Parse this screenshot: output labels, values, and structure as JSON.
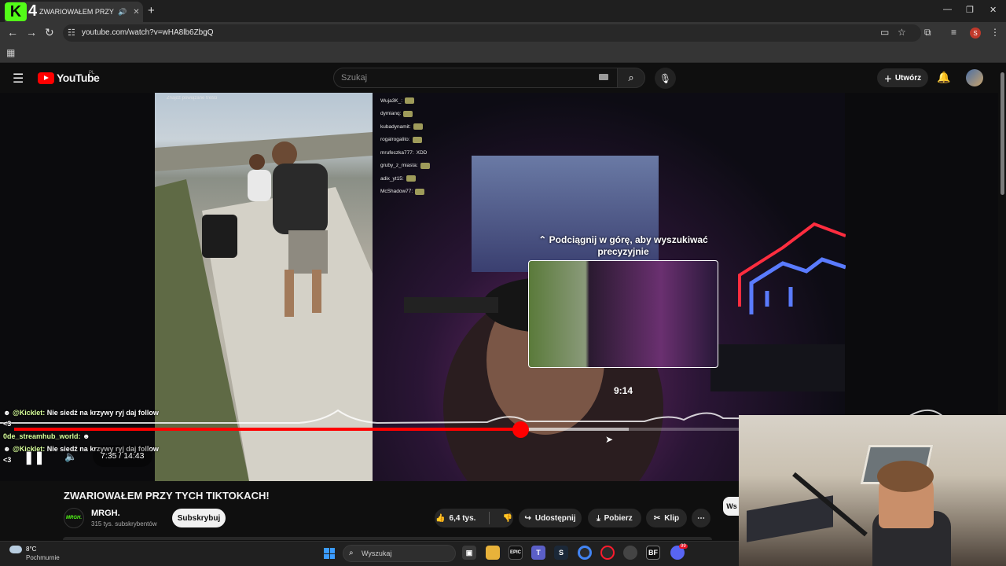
{
  "browser": {
    "tab_title": "ZWARIOWAŁEM PRZY TYCH",
    "tab_logo": "K",
    "tab_badge": "4",
    "url": "youtube.com/watch?v=wHA8lb6ZbgQ",
    "profile_initial": "S"
  },
  "youtube": {
    "logo_text": "YouTube",
    "country_code": "PL",
    "search_placeholder": "Szukaj",
    "create_label": "Utwórz"
  },
  "player": {
    "seek_hint": "Podciągnij w górę, aby wyszukiwać precyzyjnie",
    "preview_time": "9:14",
    "time_display": "7:35 / 14:43",
    "progress_fraction": 0.515,
    "tiktok_hint": "Znajdź powiązane treści",
    "chat_users": [
      "Wuja3K_:",
      "dymianq:",
      "kubadynamit:",
      "rogalrogalito:",
      "mrufeczka777:",
      "gruby_z_miasta:",
      "adix_yt15:",
      "McShadow77:"
    ],
    "chat_xdd": "XDD",
    "kick_chat": [
      {
        "user": "@Kicklet:",
        "text": "Nie siedź na krzywy ryj daj follow",
        "suffix": "<3"
      },
      {
        "user": "0de_streamhub_world:",
        "text": "",
        "suffix": ""
      },
      {
        "user": "@Kicklet:",
        "text": "Nie siedź na krzywy ryj daj follow",
        "suffix": "<3"
      }
    ]
  },
  "video": {
    "title": "ZWARIOWAŁEM PRZY TYCH TIKTOKACH!",
    "channel_name": "MRGH.",
    "channel_avatar_text": "MRGH.",
    "subscribers": "315 tys. subskrybentów",
    "subscribe_label": "Subskrybuj",
    "likes": "6,4 tys.",
    "share_label": "Udostępnij",
    "download_label": "Pobierz",
    "clip_label": "Klip",
    "side_button_label": "Ws"
  },
  "taskbar": {
    "weather_temp": "8°C",
    "weather_desc": "Pochmurnie",
    "search_placeholder": "Wyszukaj",
    "badge_count": "99"
  },
  "colors": {
    "youtube_red": "#ff0000",
    "kick_green": "#53fc18"
  }
}
